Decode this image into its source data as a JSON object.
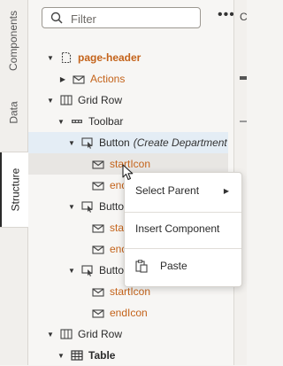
{
  "rail": {
    "tabs": [
      {
        "label": "Components"
      },
      {
        "label": "Data"
      },
      {
        "label": "Structure"
      }
    ]
  },
  "search": {
    "placeholder": "Filter",
    "value": ""
  },
  "tree": [
    {
      "label": "page-header",
      "icon": "page-icon",
      "caret": "down"
    },
    {
      "label": "Actions",
      "icon": "slot-icon",
      "caret": "right"
    },
    {
      "label": "Grid Row",
      "icon": "grid-row-icon",
      "caret": "down"
    },
    {
      "label": "Toolbar",
      "icon": "toolbar-icon",
      "caret": "down"
    },
    {
      "label": "Button",
      "suffix": "(Create Department",
      "icon": "button-icon",
      "caret": "down"
    },
    {
      "label": "startIcon",
      "icon": "slot-icon"
    },
    {
      "label": "endIcon",
      "icon": "slot-icon"
    },
    {
      "label": "Button",
      "icon": "button-icon",
      "caret": "down"
    },
    {
      "label": "startIcon",
      "icon": "slot-icon"
    },
    {
      "label": "endIcon",
      "icon": "slot-icon"
    },
    {
      "label": "Button",
      "icon": "button-icon",
      "caret": "down"
    },
    {
      "label": "startIcon",
      "icon": "slot-icon"
    },
    {
      "label": "endIcon",
      "icon": "slot-icon"
    },
    {
      "label": "Grid Row",
      "icon": "grid-row-icon",
      "caret": "down"
    },
    {
      "label": "Table",
      "icon": "table-icon",
      "caret": "down"
    }
  ],
  "context_menu": {
    "select_parent": "Select Parent",
    "insert_component": "Insert Component",
    "paste": "Paste"
  },
  "right_strip": {
    "tab_label": "C"
  },
  "colors": {
    "orange_label": "#c4631a",
    "selected_row": "#e4edf5",
    "hover_row": "#e8e6e3"
  }
}
